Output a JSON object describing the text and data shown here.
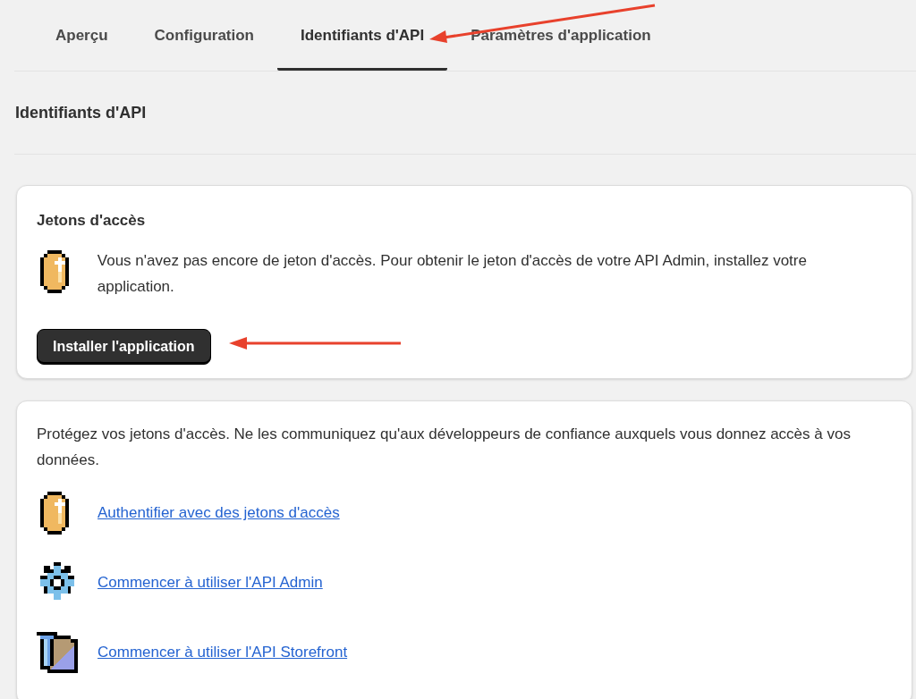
{
  "tabs": [
    {
      "label": "Aperçu",
      "selected": false
    },
    {
      "label": "Configuration",
      "selected": false
    },
    {
      "label": "Identifiants d'API",
      "selected": true
    },
    {
      "label": "Paramètres d'application",
      "selected": false
    }
  ],
  "page_title": "Identifiants d'API",
  "tokens_card": {
    "title": "Jetons d'accès",
    "message": "Vous n'avez pas encore de jeton d'accès. Pour obtenir le jeton d'accès de votre API Admin, installez votre application.",
    "button": "Installer l'application"
  },
  "info_card": {
    "message": "Protégez vos jetons d'accès. Ne les communiquez qu'aux développeurs de confiance auxquels vous donnez accès à vos données.",
    "links": [
      {
        "kind": "coin",
        "label": "Authentifier avec des jetons d'accès"
      },
      {
        "kind": "gear",
        "label": "Commencer à utiliser l'API Admin"
      },
      {
        "kind": "tools",
        "label": "Commencer à utiliser l'API Storefront"
      }
    ]
  }
}
